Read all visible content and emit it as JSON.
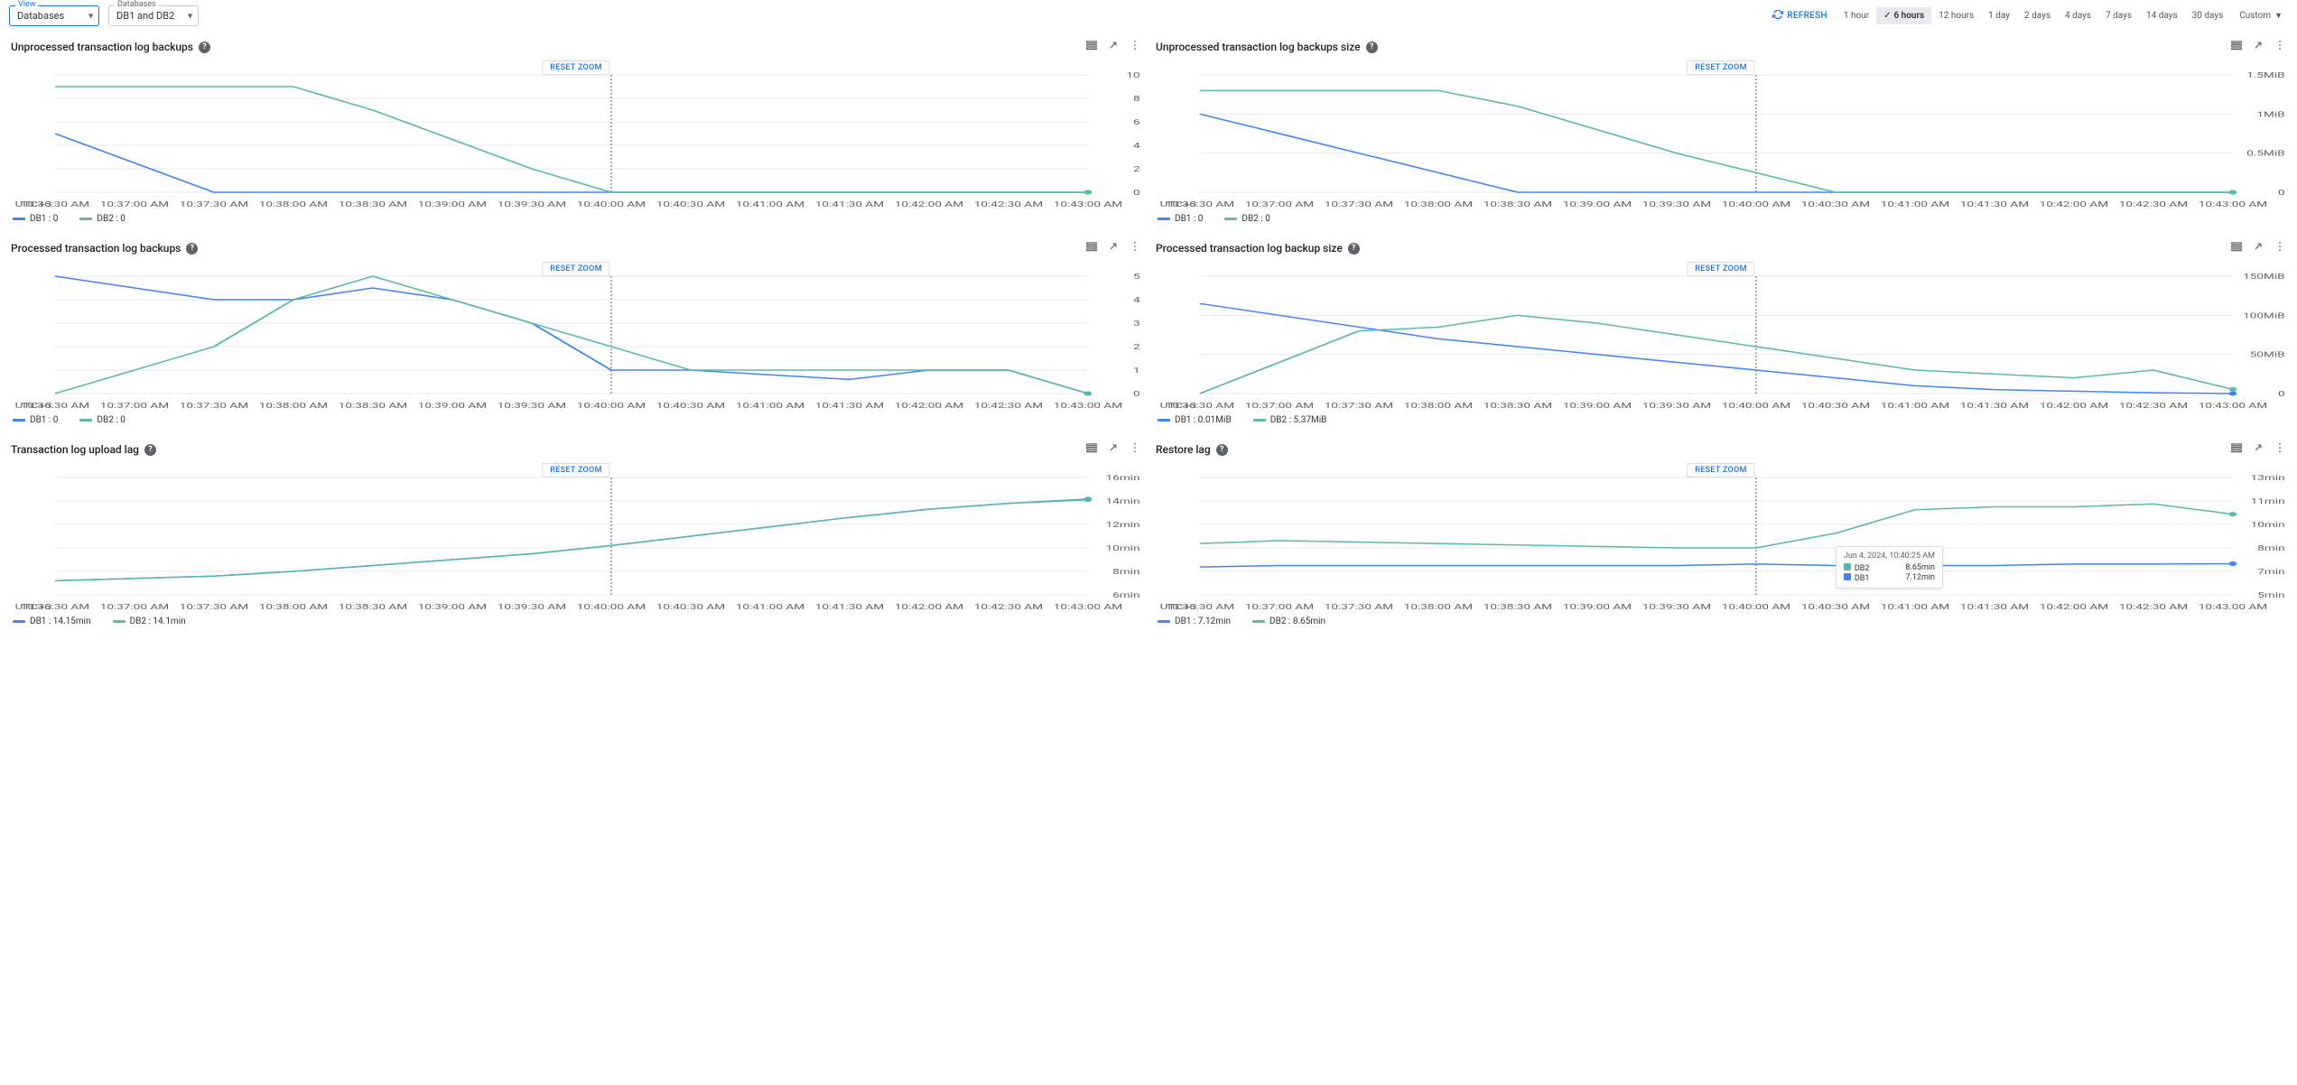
{
  "filters": {
    "view_label": "View",
    "view_value": "Databases",
    "db_label": "Databases",
    "db_value": "DB1 and DB2"
  },
  "refresh_label": "REFRESH",
  "time_ranges": [
    "1 hour",
    "6 hours",
    "12 hours",
    "1 day",
    "2 days",
    "4 days",
    "7 days",
    "14 days",
    "30 days"
  ],
  "active_range": "6 hours",
  "custom_label": "Custom",
  "reset_zoom_label": "RESET ZOOM",
  "x_axis_label": "UTC+3",
  "x_ticks": [
    "10:36:30 AM",
    "10:37:00 AM",
    "10:37:30 AM",
    "10:38:00 AM",
    "10:38:30 AM",
    "10:39:00 AM",
    "10:39:30 AM",
    "10:40:00 AM",
    "10:40:30 AM",
    "10:41:00 AM",
    "10:41:30 AM",
    "10:42:00 AM",
    "10:42:30 AM",
    "10:43:00 AM"
  ],
  "colors": {
    "db1": "#4285f4",
    "db2": "#5bb9a9"
  },
  "tooltip": {
    "time": "Jun 4, 2024, 10:40:25 AM",
    "rows": [
      {
        "name": "DB2",
        "value": "8.65min"
      },
      {
        "name": "DB1",
        "value": "7.12min"
      }
    ]
  },
  "chart_data": [
    {
      "title": "Unprocessed transaction log backups",
      "type": "line",
      "x": [
        "10:36:30",
        "10:37:00",
        "10:37:30",
        "10:38:00",
        "10:38:30",
        "10:39:00",
        "10:39:30",
        "10:40:00",
        "10:40:30",
        "10:41:00",
        "10:41:30",
        "10:42:00",
        "10:42:30",
        "10:43:00"
      ],
      "y_ticks": [
        "0",
        "2",
        "4",
        "6",
        "8",
        "10"
      ],
      "ylim": [
        0,
        10
      ],
      "series": [
        {
          "name": "DB1",
          "values": [
            5,
            2.5,
            0,
            0,
            0,
            0,
            0,
            0,
            0,
            0,
            0,
            0,
            0,
            0
          ]
        },
        {
          "name": "DB2",
          "values": [
            9,
            9,
            9,
            9,
            7,
            4.5,
            2,
            0,
            0,
            0,
            0,
            0,
            0,
            0
          ]
        }
      ],
      "legend": [
        {
          "name": "DB1",
          "value": "0"
        },
        {
          "name": "DB2",
          "value": "0"
        }
      ],
      "zoom_x_index": 7
    },
    {
      "title": "Unprocessed transaction log backups size",
      "type": "line",
      "x": [
        "10:36:30",
        "10:37:00",
        "10:37:30",
        "10:38:00",
        "10:38:30",
        "10:39:00",
        "10:39:30",
        "10:40:00",
        "10:40:30",
        "10:41:00",
        "10:41:30",
        "10:42:00",
        "10:42:30",
        "10:43:00"
      ],
      "y_ticks": [
        "0",
        "0.5MiB",
        "1MiB",
        "1.5MiB"
      ],
      "ylim": [
        0,
        1.5
      ],
      "series": [
        {
          "name": "DB1",
          "values": [
            1.0,
            0.75,
            0.5,
            0.25,
            0,
            0,
            0,
            0,
            0,
            0,
            0,
            0,
            0,
            0
          ]
        },
        {
          "name": "DB2",
          "values": [
            1.3,
            1.3,
            1.3,
            1.3,
            1.1,
            0.8,
            0.5,
            0.25,
            0,
            0,
            0,
            0,
            0,
            0
          ]
        }
      ],
      "legend": [
        {
          "name": "DB1",
          "value": "0"
        },
        {
          "name": "DB2",
          "value": "0"
        }
      ],
      "zoom_x_index": 7
    },
    {
      "title": "Processed transaction log backups",
      "type": "line",
      "x": [
        "10:36:30",
        "10:37:00",
        "10:37:30",
        "10:38:00",
        "10:38:30",
        "10:39:00",
        "10:39:30",
        "10:40:00",
        "10:40:30",
        "10:41:00",
        "10:41:30",
        "10:42:00",
        "10:42:30",
        "10:43:00"
      ],
      "y_ticks": [
        "0",
        "1",
        "2",
        "3",
        "4",
        "5"
      ],
      "ylim": [
        0,
        5
      ],
      "series": [
        {
          "name": "DB1",
          "values": [
            5,
            4.5,
            4,
            4,
            4.5,
            4,
            3,
            1,
            1,
            0.8,
            0.6,
            1,
            1,
            0
          ]
        },
        {
          "name": "DB2",
          "values": [
            0,
            1,
            2,
            4,
            5,
            4,
            3,
            2,
            1,
            1,
            1,
            1,
            1,
            0
          ]
        }
      ],
      "legend": [
        {
          "name": "DB1",
          "value": "0"
        },
        {
          "name": "DB2",
          "value": "0"
        }
      ],
      "zoom_x_index": 7
    },
    {
      "title": "Processed transaction log backup size",
      "type": "line",
      "x": [
        "10:36:30",
        "10:37:00",
        "10:37:30",
        "10:38:00",
        "10:38:30",
        "10:39:00",
        "10:39:30",
        "10:40:00",
        "10:40:30",
        "10:41:00",
        "10:41:30",
        "10:42:00",
        "10:42:30",
        "10:43:00"
      ],
      "y_ticks": [
        "0",
        "50MiB",
        "100MiB",
        "150MiB"
      ],
      "ylim": [
        0,
        150
      ],
      "series": [
        {
          "name": "DB1",
          "values": [
            115,
            100,
            85,
            70,
            60,
            50,
            40,
            30,
            20,
            10,
            5,
            3,
            1,
            0.01
          ]
        },
        {
          "name": "DB2",
          "values": [
            0,
            40,
            80,
            85,
            100,
            90,
            75,
            60,
            45,
            30,
            25,
            20,
            30,
            5.37
          ]
        }
      ],
      "legend": [
        {
          "name": "DB1",
          "value": "0.01MiB"
        },
        {
          "name": "DB2",
          "value": "5.37MiB"
        }
      ],
      "zoom_x_index": 7
    },
    {
      "title": "Transaction log upload lag",
      "type": "line",
      "x": [
        "10:36:30",
        "10:37:00",
        "10:37:30",
        "10:38:00",
        "10:38:30",
        "10:39:00",
        "10:39:30",
        "10:40:00",
        "10:40:30",
        "10:41:00",
        "10:41:30",
        "10:42:00",
        "10:42:30",
        "10:43:00"
      ],
      "y_ticks": [
        "6min",
        "8min",
        "10min",
        "12min",
        "14min",
        "16min"
      ],
      "ylim": [
        6,
        16
      ],
      "series": [
        {
          "name": "DB1",
          "values": [
            7.2,
            7.4,
            7.6,
            8,
            8.5,
            9,
            9.5,
            10.2,
            11,
            11.8,
            12.6,
            13.3,
            13.8,
            14.15
          ]
        },
        {
          "name": "DB2",
          "values": [
            7.2,
            7.4,
            7.6,
            8,
            8.5,
            9,
            9.5,
            10.2,
            11,
            11.8,
            12.6,
            13.3,
            13.8,
            14.1
          ]
        }
      ],
      "legend": [
        {
          "name": "DB1",
          "value": "14.15min"
        },
        {
          "name": "DB2",
          "value": "14.1min"
        }
      ],
      "zoom_x_index": 7
    },
    {
      "title": "Restore lag",
      "type": "line",
      "x": [
        "10:36:30",
        "10:37:00",
        "10:37:30",
        "10:38:00",
        "10:38:30",
        "10:39:00",
        "10:39:30",
        "10:40:00",
        "10:40:30",
        "10:41:00",
        "10:41:30",
        "10:42:00",
        "10:42:30",
        "10:43:00"
      ],
      "y_ticks": [
        "5min",
        "7min",
        "8min",
        "10min",
        "11min",
        "13min"
      ],
      "ylim": [
        5,
        13
      ],
      "series": [
        {
          "name": "DB1",
          "values": [
            6.9,
            7,
            7,
            7,
            7,
            7,
            7,
            7.1,
            7,
            7,
            7,
            7.1,
            7.1,
            7.12
          ]
        },
        {
          "name": "DB2",
          "values": [
            8.5,
            8.7,
            8.6,
            8.5,
            8.4,
            8.3,
            8.2,
            8.2,
            9.2,
            10.8,
            11,
            11,
            11.2,
            10.5
          ]
        }
      ],
      "legend": [
        {
          "name": "DB1",
          "value": "7.12min"
        },
        {
          "name": "DB2",
          "value": "8.65min"
        }
      ],
      "zoom_x_index": 7,
      "tooltip_at_index": 8
    }
  ]
}
